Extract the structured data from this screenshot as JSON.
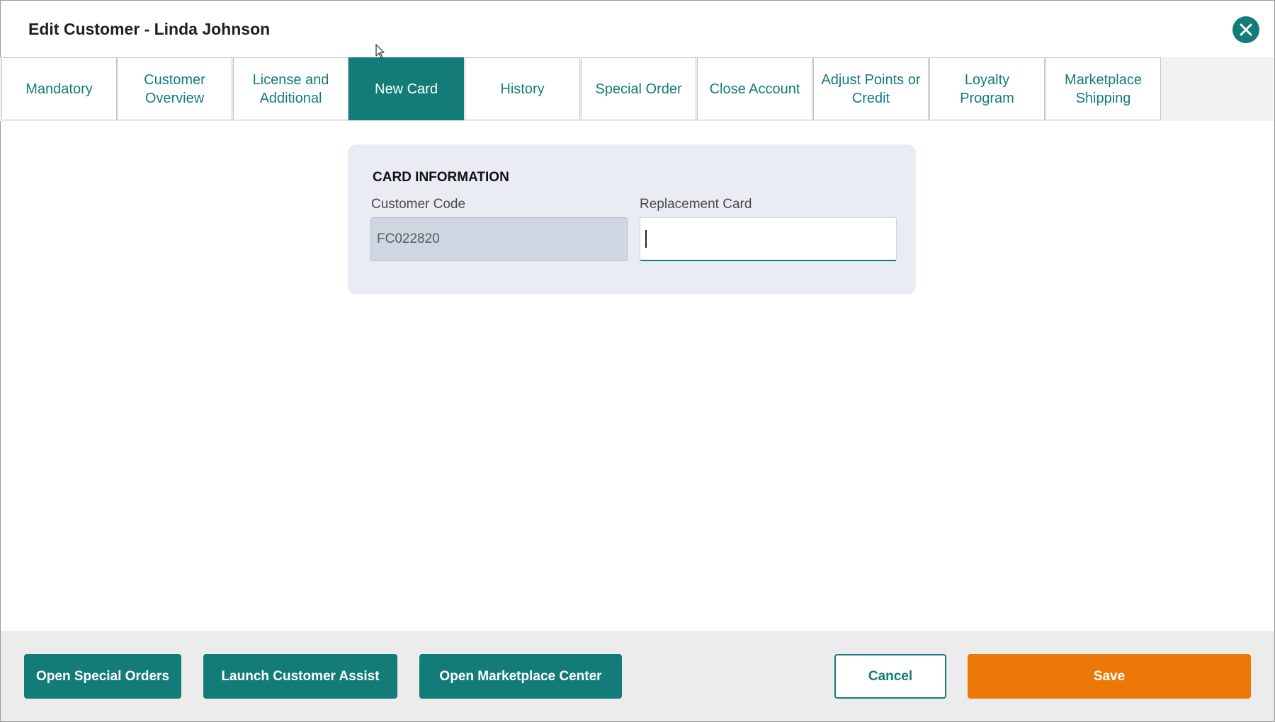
{
  "window": {
    "title": "Edit Customer - Linda Johnson",
    "close_icon": "close-icon"
  },
  "tabs": [
    {
      "label": "Mandatory",
      "active": false
    },
    {
      "label": "Customer Overview",
      "active": false
    },
    {
      "label": "License and Additional",
      "active": false
    },
    {
      "label": "New Card",
      "active": true
    },
    {
      "label": "History",
      "active": false
    },
    {
      "label": "Special Order",
      "active": false
    },
    {
      "label": "Close Account",
      "active": false
    },
    {
      "label": "Adjust Points or Credit",
      "active": false
    },
    {
      "label": "Loyalty Program",
      "active": false
    },
    {
      "label": "Marketplace Shipping",
      "active": false
    }
  ],
  "card_info": {
    "heading": "CARD INFORMATION",
    "customer_code_label": "Customer Code",
    "customer_code_value": "FC022820",
    "replacement_card_label": "Replacement Card",
    "replacement_card_value": ""
  },
  "footer": {
    "open_special_orders": "Open Special Orders",
    "launch_customer_assist": "Launch Customer Assist",
    "open_marketplace_center": "Open Marketplace Center",
    "cancel": "Cancel",
    "save": "Save"
  },
  "colors": {
    "accent": "#137c79",
    "save": "#ec7808",
    "panel": "#e9ecf2"
  }
}
